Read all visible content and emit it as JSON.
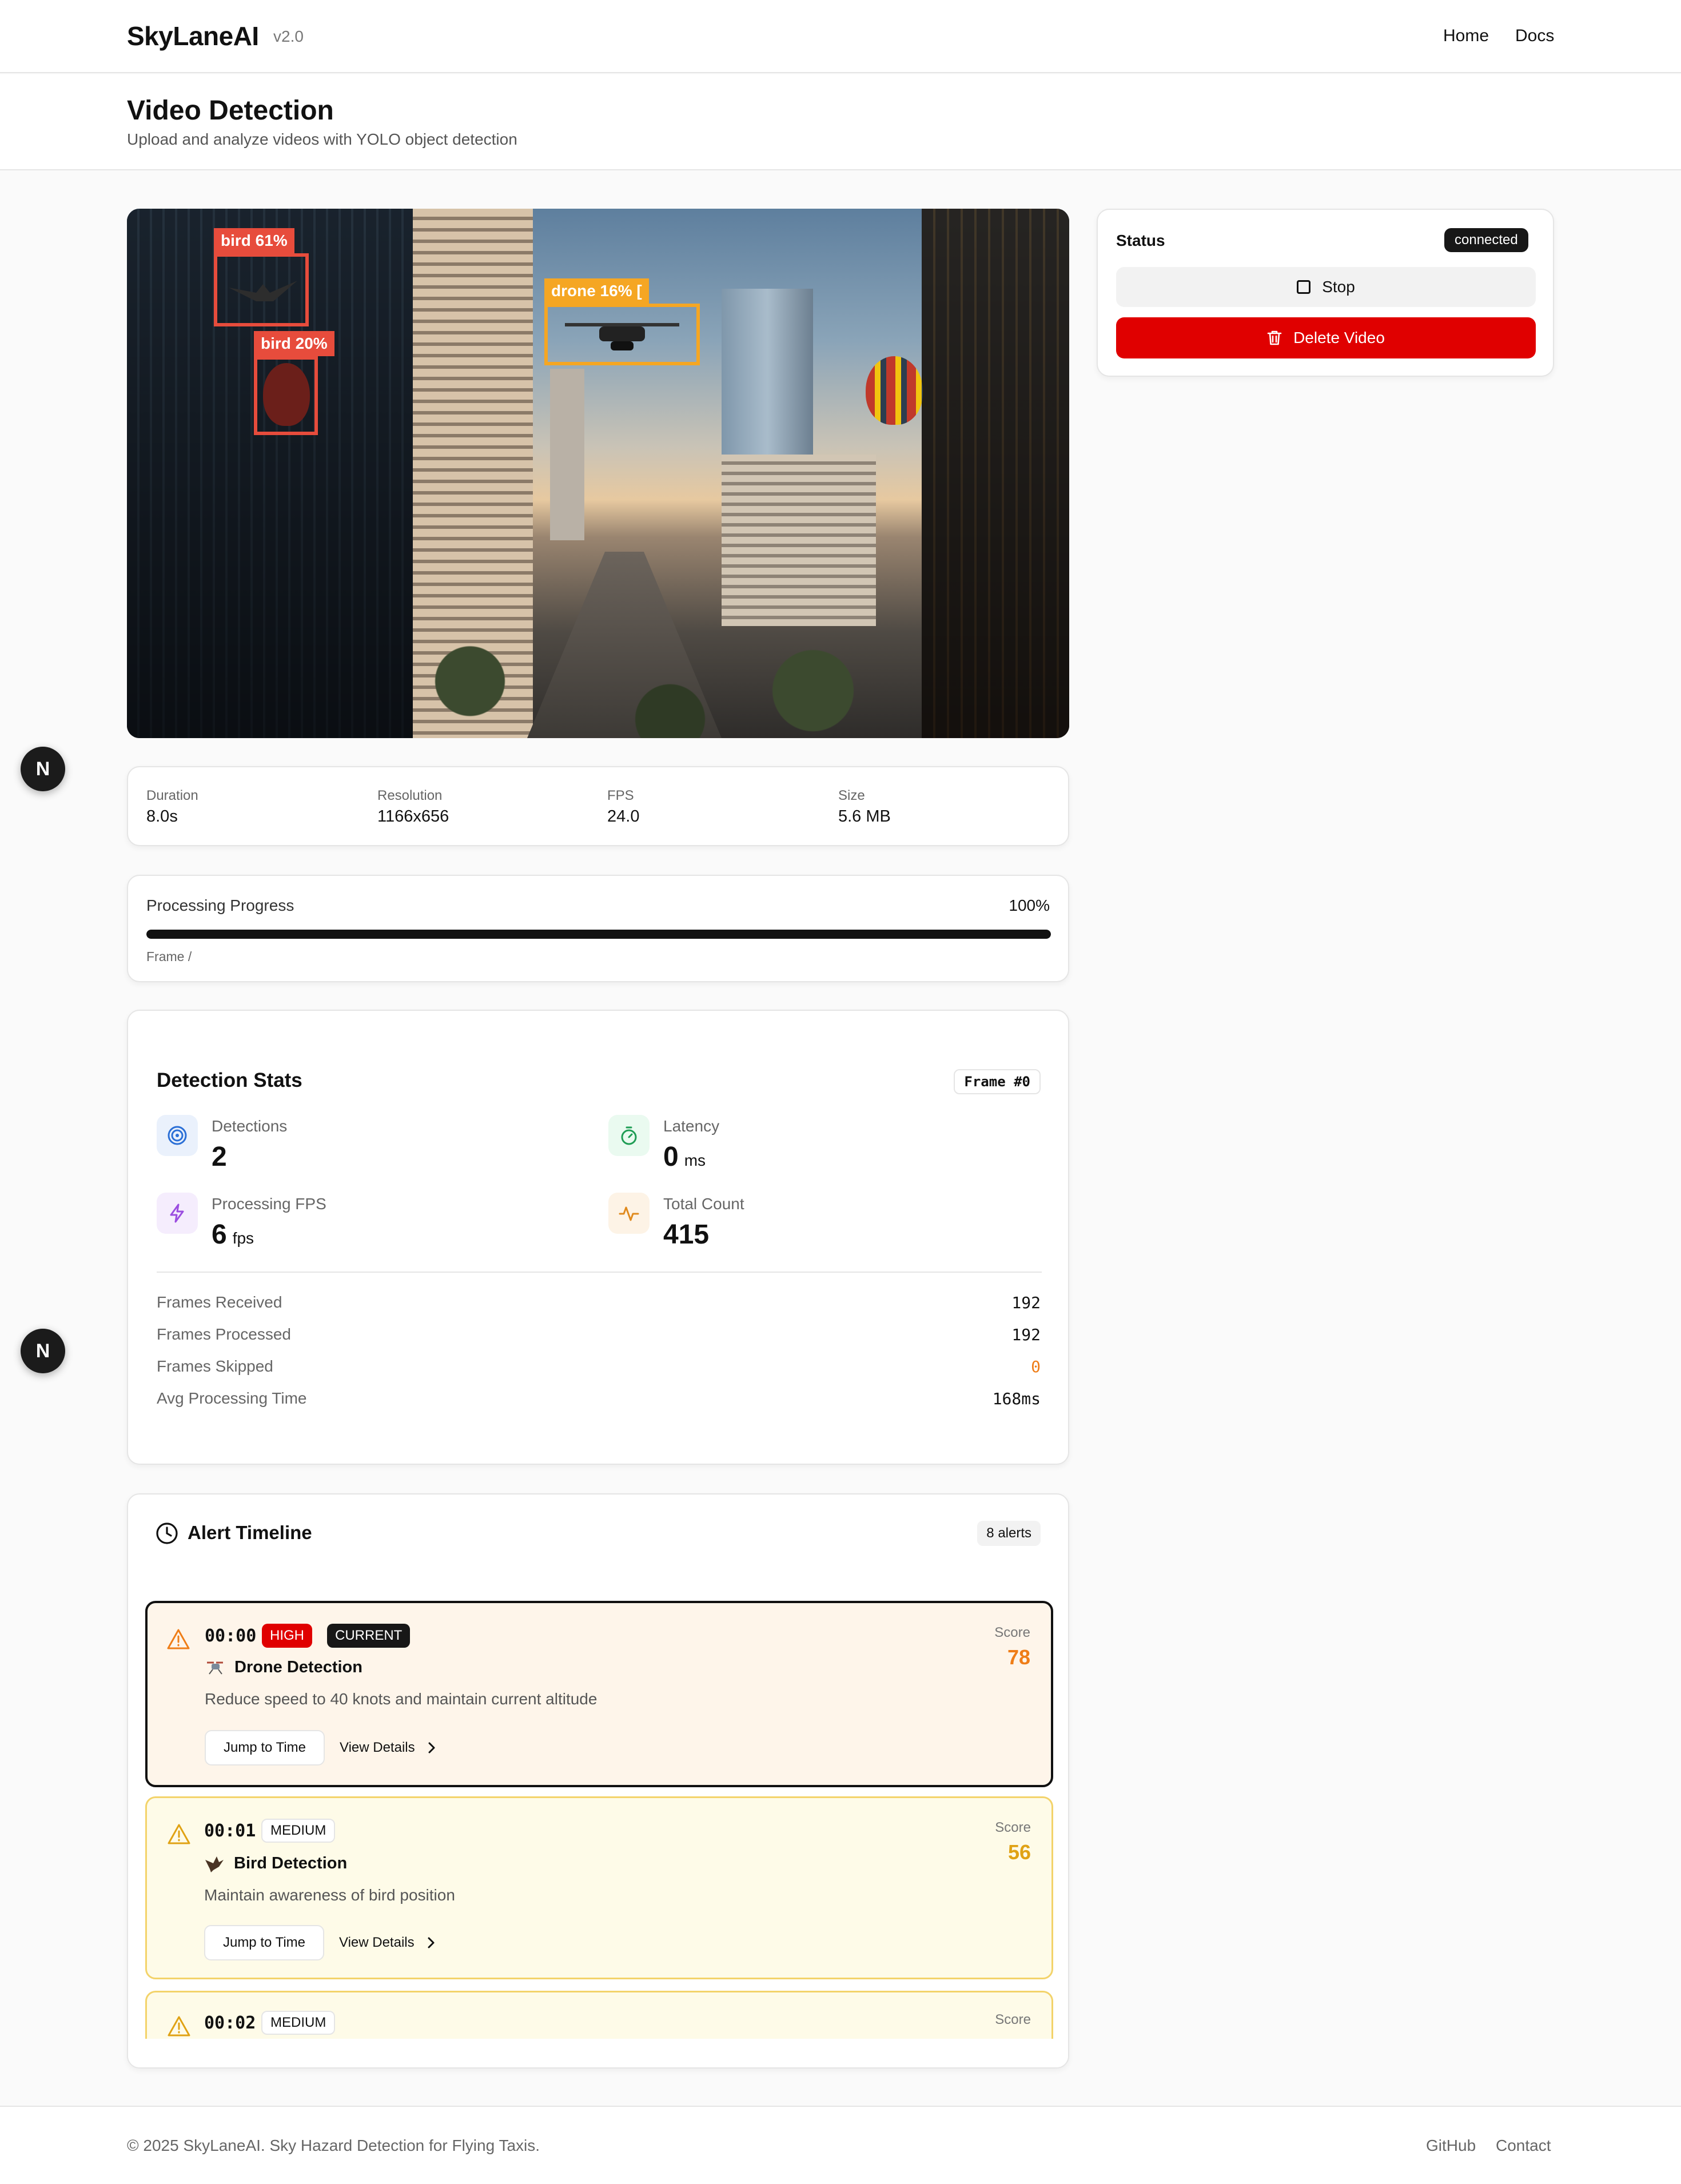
{
  "header": {
    "brand": "SkyLaneAI",
    "version": "v2.0",
    "nav": [
      "Home",
      "Docs"
    ]
  },
  "page": {
    "title": "Video Detection",
    "subtitle": "Upload and analyze videos with YOLO object detection"
  },
  "video": {
    "detections": [
      {
        "label": "bird 61%",
        "color": "#e74c3c"
      },
      {
        "label": "bird 20%",
        "color": "#e74c3c"
      },
      {
        "label": "drone 16% [",
        "color": "#f5a623"
      }
    ]
  },
  "status": {
    "title": "Status",
    "badge": "connected",
    "stop_label": "Stop",
    "delete_label": "Delete Video"
  },
  "meta": {
    "duration_label": "Duration",
    "duration": "8.0s",
    "resolution_label": "Resolution",
    "resolution": "1166x656",
    "fps_label": "FPS",
    "fps": "24.0",
    "size_label": "Size",
    "size": "5.6 MB"
  },
  "progress": {
    "label": "Processing Progress",
    "percent_text": "100%",
    "fraction": 1.0,
    "frame_text": "Frame /"
  },
  "stats": {
    "title": "Detection Stats",
    "frame_badge": "Frame #0",
    "detections_label": "Detections",
    "detections": "2",
    "latency_label": "Latency",
    "latency": "0",
    "latency_unit": "ms",
    "fps_label": "Processing FPS",
    "fps": "6",
    "fps_unit": "fps",
    "total_label": "Total Count",
    "total": "415",
    "rows": [
      {
        "label": "Frames Received",
        "value": "192"
      },
      {
        "label": "Frames Processed",
        "value": "192"
      },
      {
        "label": "Frames Skipped",
        "value": "0"
      },
      {
        "label": "Avg Processing Time",
        "value": "168ms"
      }
    ]
  },
  "timeline": {
    "title": "Alert Timeline",
    "count_badge": "8 alerts",
    "alerts": [
      {
        "time": "00:00",
        "severity": "HIGH",
        "current": "CURRENT",
        "title": "Drone Detection",
        "desc": "Reduce speed to 40 knots and maintain current altitude",
        "score_label": "Score",
        "score": "78",
        "jump": "Jump to Time",
        "view": "View Details"
      },
      {
        "time": "00:01",
        "severity": "MEDIUM",
        "title": "Bird Detection",
        "desc": "Maintain awareness of bird position",
        "score_label": "Score",
        "score": "56",
        "jump": "Jump to Time",
        "view": "View Details"
      },
      {
        "time": "00:02",
        "severity": "MEDIUM",
        "score_label": "Score"
      }
    ]
  },
  "fab_letter": "N",
  "footer": {
    "copyright": "© 2025 SkyLaneAI. Sky Hazard Detection for Flying Taxis.",
    "links": [
      "GitHub",
      "Contact"
    ]
  }
}
